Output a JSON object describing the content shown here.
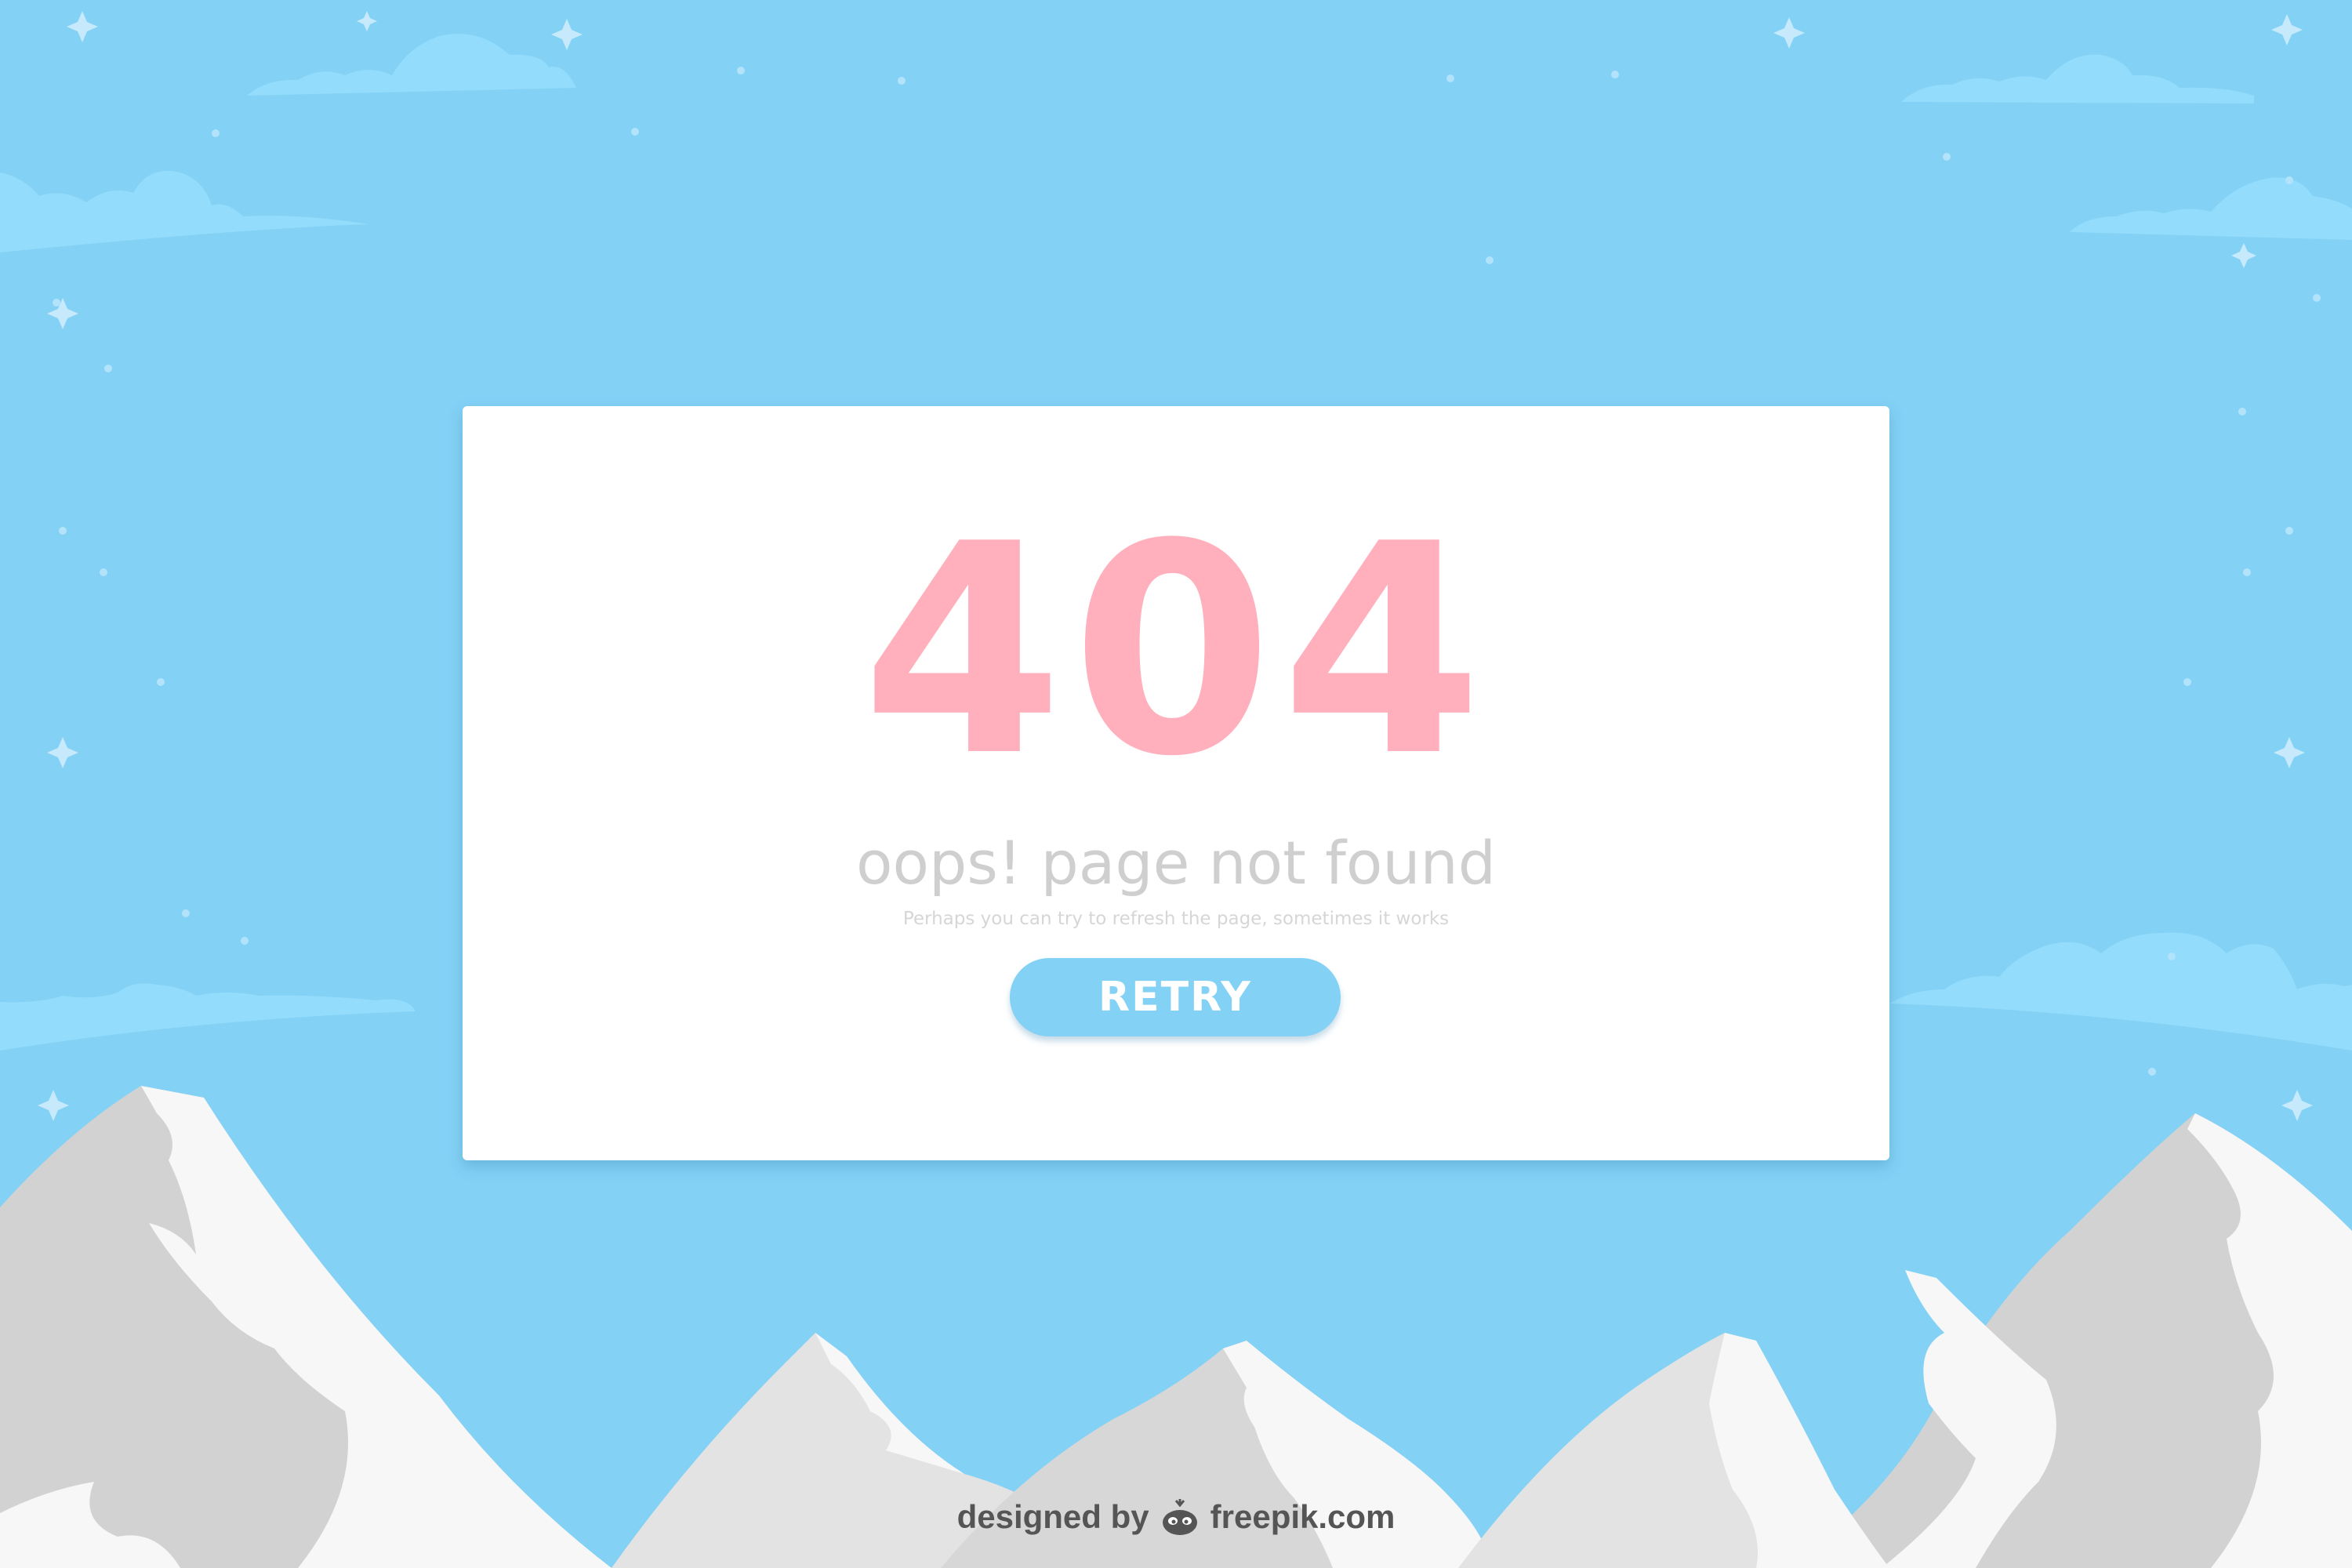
{
  "colors": {
    "sky": "#83d1f5",
    "cloud": "#93dcfb",
    "card": "#ffffff",
    "error_code": "#ffb0bc",
    "headline": "#cfcfcf",
    "subtitle": "#d6d6d6",
    "button": "#83d1f5",
    "mountain_shadow": "#d2d2d2",
    "mountain_snow": "#f7f7f7",
    "credit_text": "#555555"
  },
  "error_card": {
    "code": "404",
    "headline": "oops! page not found",
    "subtitle": "Perhaps you can try to refresh the page, sometimes it works",
    "retry_label": "RETRY"
  },
  "credit": {
    "designed_by": "designed by",
    "brand": "freepik.com",
    "logo_icon": "freepik-logo-icon"
  }
}
